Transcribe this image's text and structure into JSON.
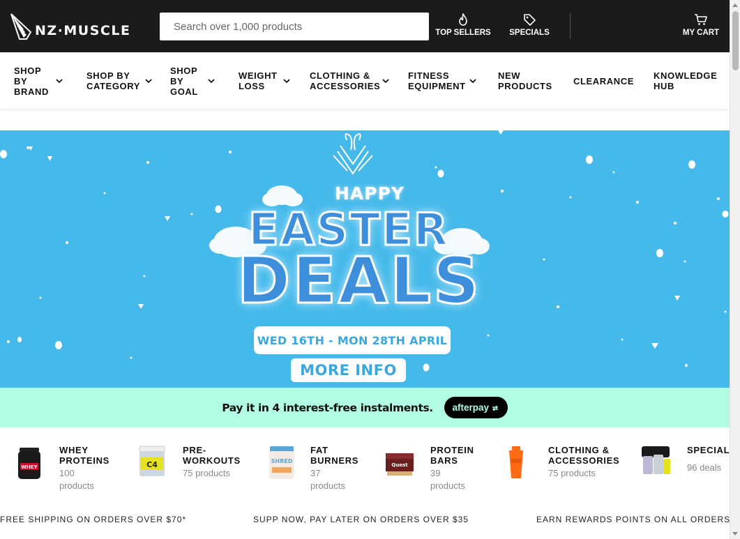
{
  "header": {
    "logo_text": "NZ·MUSCLE",
    "search_placeholder": "Search over 1,000 products",
    "links": [
      {
        "label": "TOP SELLERS",
        "icon": "flame-icon"
      },
      {
        "label": "SPECIALS",
        "icon": "tag-icon"
      },
      {
        "label": "MY CART",
        "icon": "cart-icon"
      }
    ]
  },
  "nav": [
    {
      "label": "SHOP BY BRAND",
      "dropdown": true
    },
    {
      "label": "SHOP BY CATEGORY",
      "dropdown": true
    },
    {
      "label": "SHOP BY GOAL",
      "dropdown": true
    },
    {
      "label": "WEIGHT LOSS",
      "dropdown": true
    },
    {
      "label": "CLOTHING & ACCESSORIES",
      "dropdown": true
    },
    {
      "label": "FITNESS EQUIPMENT",
      "dropdown": true
    },
    {
      "label": "NEW PRODUCTS",
      "dropdown": false
    },
    {
      "label": "CLEARANCE",
      "dropdown": false
    },
    {
      "label": "KNOWLEDGE HUB",
      "dropdown": false
    }
  ],
  "hero": {
    "happy": "HAPPY",
    "easter": "EASTER",
    "deals": "DEALS",
    "dates": "WED 16TH - MON 28TH APRIL",
    "more_info": "MORE INFO",
    "background_color": "#45b9ea"
  },
  "afterpay": {
    "text": "Pay it in 4 interest-free instalments.",
    "badge": "afterpay"
  },
  "categories": [
    {
      "title": "WHEY PROTEINS",
      "count": "100 products"
    },
    {
      "title": "PRE-WORKOUTS",
      "count": "75 products"
    },
    {
      "title": "FAT BURNERS",
      "count": "37 products"
    },
    {
      "title": "PROTEIN BARS",
      "count": "39 products"
    },
    {
      "title": "CLOTHING & ACCESSORIES",
      "count": "75 products"
    },
    {
      "title": "SPECIALS",
      "count": "96 deals"
    }
  ],
  "marquee": [
    "FREE SHIPPING ON ORDERS OVER $70*",
    "SUPP NOW, PAY LATER ON ORDERS OVER $35",
    "EARN REWARDS POINTS ON ALL ORDERS"
  ]
}
